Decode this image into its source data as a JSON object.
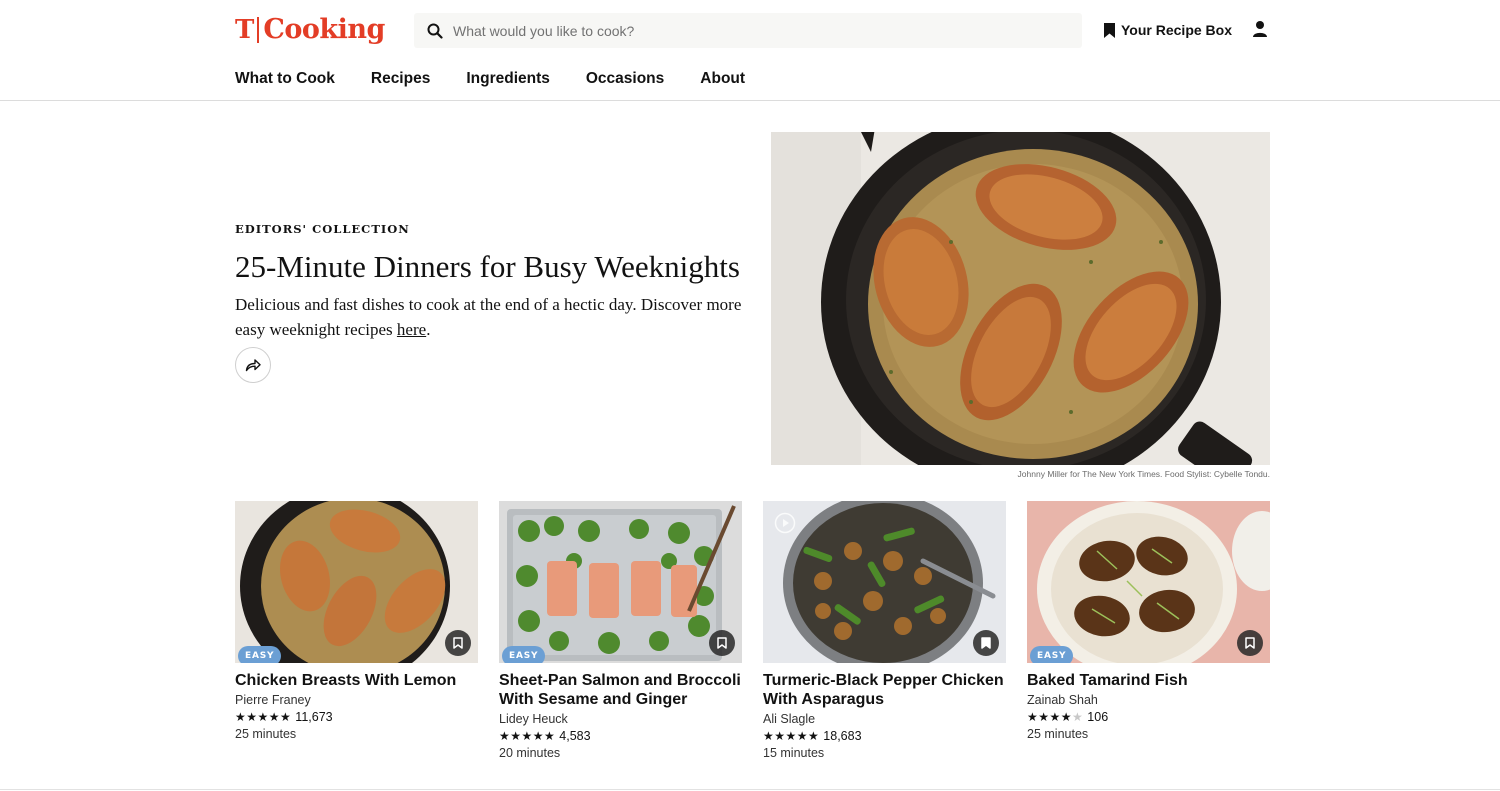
{
  "header": {
    "logo_t": "T",
    "logo_word": "Cooking",
    "search_placeholder": "What would you like to cook?",
    "recipe_box_label": "Your Recipe Box",
    "brand_color": "#e33d26"
  },
  "nav": {
    "items": [
      {
        "label": "What to Cook"
      },
      {
        "label": "Recipes"
      },
      {
        "label": "Ingredients"
      },
      {
        "label": "Occasions"
      },
      {
        "label": "About"
      }
    ]
  },
  "hero": {
    "kicker": "EDITORS' COLLECTION",
    "title": "25-Minute Dinners for Busy Weeknights",
    "description_before": "Delicious and fast dishes to cook at the end of a hectic day. Discover more easy weeknight recipes ",
    "description_link": "here",
    "description_after": ".",
    "credit": "Johnny Miller for The New York Times. Food Stylist: Cybelle Tondu."
  },
  "cards": [
    {
      "title": "Chicken Breasts With Lemon",
      "author": "Pierre Franey",
      "stars": "★★★★★",
      "stars_dim": "",
      "rating_count": "11,673",
      "time": "25 minutes",
      "badge": "EASY"
    },
    {
      "title": "Sheet-Pan Salmon and Broccoli With Sesame and Ginger",
      "author": "Lidey Heuck",
      "stars": "★★★★★",
      "stars_dim": "",
      "rating_count": "4,583",
      "time": "20 minutes",
      "badge": "EASY"
    },
    {
      "title": "Turmeric-Black Pepper Chicken With Asparagus",
      "author": "Ali Slagle",
      "stars": "★★★★★",
      "stars_dim": "",
      "rating_count": "18,683",
      "time": "15 minutes",
      "badge": ""
    },
    {
      "title": "Baked Tamarind Fish",
      "author": "Zainab Shah",
      "stars": "★★★★",
      "stars_dim": "★",
      "rating_count": "106",
      "time": "25 minutes",
      "badge": "EASY"
    }
  ]
}
